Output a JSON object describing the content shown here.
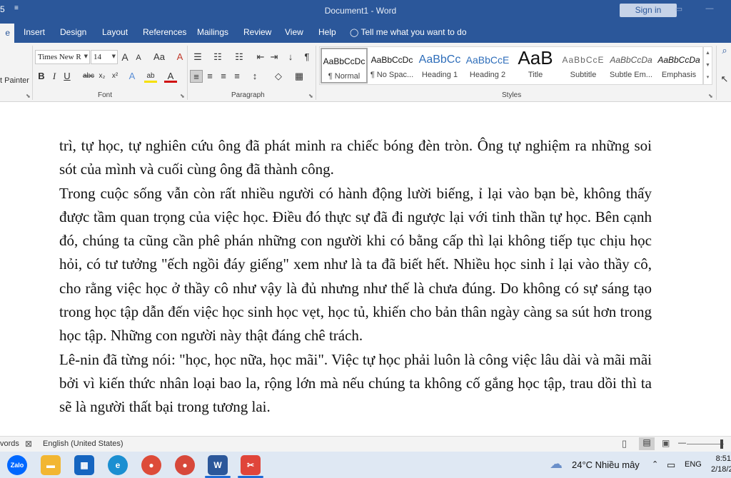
{
  "titlebar": {
    "qa_icon_1": "5",
    "qa_icon_2": "≡",
    "title": "Document1  -  Word",
    "signin": "Sign in",
    "restore_glyph": "▭",
    "minimize_glyph": "—"
  },
  "tabs": {
    "home": "e",
    "insert": "Insert",
    "design": "Design",
    "layout": "Layout",
    "references": "References",
    "mailings": "Mailings",
    "review": "Review",
    "view": "View",
    "help": "Help",
    "tell_me": "Tell me what you want to do",
    "bulb_icon": "◯"
  },
  "ribbon": {
    "clipboard": {
      "format_painter": "t Painter"
    },
    "font": {
      "label": "Font",
      "font_name": "Times New R",
      "font_size": "14",
      "grow": "A",
      "shrink": "A",
      "change_case": "Aa",
      "clear": "A",
      "bold": "B",
      "italic": "I",
      "underline": "U",
      "strike": "abc",
      "subscript": "x₂",
      "superscript": "x²",
      "text_effects": "A",
      "highlight": "ab",
      "font_color": "A"
    },
    "paragraph": {
      "label": "Paragraph",
      "bullets": "☰",
      "numbering": "☷",
      "multilevel": "☷",
      "decrease_indent": "⇤",
      "increase_indent": "⇥",
      "sort": "↓",
      "pilcrow": "¶",
      "align_left": "≡",
      "align_center": "≡",
      "align_right": "≡",
      "justify": "≡",
      "line_spacing": "↕",
      "shading": "◇",
      "borders": "▦"
    },
    "styles": {
      "label": "Styles",
      "items": [
        {
          "preview": "AaBbCcDc",
          "name": "¶ Normal"
        },
        {
          "preview": "AaBbCcDc",
          "name": "¶ No Spac..."
        },
        {
          "preview": "AaBbCc",
          "name": "Heading 1"
        },
        {
          "preview": "AaBbCcE",
          "name": "Heading 2"
        },
        {
          "preview": "AaB",
          "name": "Title"
        },
        {
          "preview": "AaBbCcE",
          "name": "Subtitle"
        },
        {
          "preview": "AaBbCcDa",
          "name": "Subtle Em..."
        },
        {
          "preview": "AaBbCcDa",
          "name": "Emphasis"
        }
      ],
      "scroll_up": "▲",
      "scroll_down": "▼",
      "more": "▾"
    },
    "editing": {
      "find_icon": "⌕",
      "select_icon": "↖"
    }
  },
  "document": {
    "paragraphs": [
      "trì, tự học, tự nghiên cứu ông đã phát minh ra chiếc bóng đèn tròn. Ông tự nghiệm ra những soi sót của mình và cuối cùng ông đã thành công.",
      "Trong cuộc sống vẫn còn rất nhiều người có hành động lười biếng, ỉ lại vào bạn bè, không thấy được tầm quan trọng của việc học. Điều đó thực sự đã đi ngược lại với tinh thần tự học. Bên cạnh đó, chúng ta cũng cần phê phán những con người khi có bằng cấp thì lại không tiếp tục chịu học hỏi, có tư tưởng \"ếch ngồi đáy giếng\" xem như là ta đã biết hết. Nhiều học sinh ỉ lại vào thầy cô, cho rằng việc học ở thầy cô như vậy là đủ nhưng như thế là chưa đúng. Do không có sự sáng tạo trong học tập dẫn đến việc học sinh học vẹt, học tủ, khiến cho bản thân ngày càng sa sút hơn trong học tập. Những con người này thật đáng chê trách.",
      "Lê-nin đã từng nói: \"học, học nữa, học mãi\". Việc tự học phải luôn là công việc lâu dài và mãi mãi bởi vì kiến thức nhân loại bao la, rộng lớn mà nếu chúng ta không cố gắng học tập, trau dồi thì ta sẽ là người thất bại trong tương lai."
    ]
  },
  "statusbar": {
    "words": "vords",
    "language": "English (United States)",
    "zoom_minus": "—",
    "zoom_plus": "+"
  },
  "taskbar": {
    "apps": [
      {
        "name": "zalo-icon",
        "text": "Zalo",
        "color": "#0068ff"
      },
      {
        "name": "file-explorer-icon",
        "text": "▬",
        "color": "#f2b632"
      },
      {
        "name": "store-icon",
        "text": "▦",
        "color": "#1565c0"
      },
      {
        "name": "edge-icon",
        "text": "e",
        "color": "#1b8fd1"
      },
      {
        "name": "chrome-icon",
        "text": "●",
        "color": "#dd4b39"
      },
      {
        "name": "chrome-alt-icon",
        "text": "●",
        "color": "#d7483b"
      },
      {
        "name": "word-icon",
        "text": "W",
        "color": "#2b579a"
      },
      {
        "name": "snipping-icon",
        "text": "✂",
        "color": "#e0453a"
      }
    ],
    "weather": "24°C  Nhiều mây",
    "lang": "ENG",
    "time": "8:51",
    "date": "2/18/2"
  },
  "colors": {
    "word_blue": "#2b579a",
    "ribbon_bg": "#f3f3f3",
    "taskbar_bg": "#dfe8f3"
  }
}
